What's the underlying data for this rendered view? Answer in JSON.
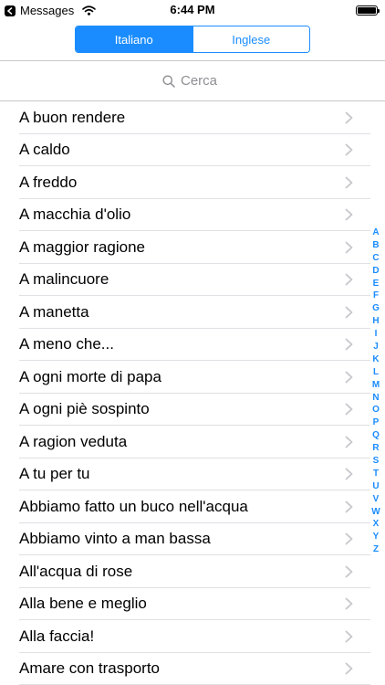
{
  "status_bar": {
    "back_app_label": "Messages",
    "time": "6:44 PM",
    "battery_level": 1.0
  },
  "segmented_control": {
    "segments": [
      {
        "label": "Italiano",
        "selected": true
      },
      {
        "label": "Inglese",
        "selected": false
      }
    ]
  },
  "search": {
    "placeholder": "Cerca",
    "value": ""
  },
  "list": {
    "items": [
      "A buon rendere",
      "A caldo",
      "A freddo",
      "A macchia d'olio",
      "A maggior ragione",
      "A malincuore",
      "A manetta",
      "A meno che...",
      "A ogni morte di papa",
      "A ogni piè sospinto",
      "A ragion veduta",
      "A tu per tu",
      "Abbiamo fatto un buco nell'acqua",
      "Abbiamo vinto a man bassa",
      "All'acqua di rose",
      "Alla bene e meglio",
      "Alla faccia!",
      "Amare con trasporto"
    ]
  },
  "section_index": [
    "A",
    "B",
    "C",
    "D",
    "E",
    "F",
    "G",
    "H",
    "I",
    "J",
    "K",
    "L",
    "M",
    "N",
    "O",
    "P",
    "Q",
    "R",
    "S",
    "T",
    "U",
    "V",
    "W",
    "X",
    "Y",
    "Z"
  ],
  "colors": {
    "accent": "#1a8cff",
    "separator": "#e0e0e5",
    "placeholder": "#8e8e93",
    "chevron": "#c7c7cc"
  },
  "icons": {
    "back": "back-triangle-icon",
    "wifi": "wifi-icon",
    "battery": "battery-icon",
    "search": "magnifier-icon",
    "disclosure": "chevron-right-icon"
  }
}
